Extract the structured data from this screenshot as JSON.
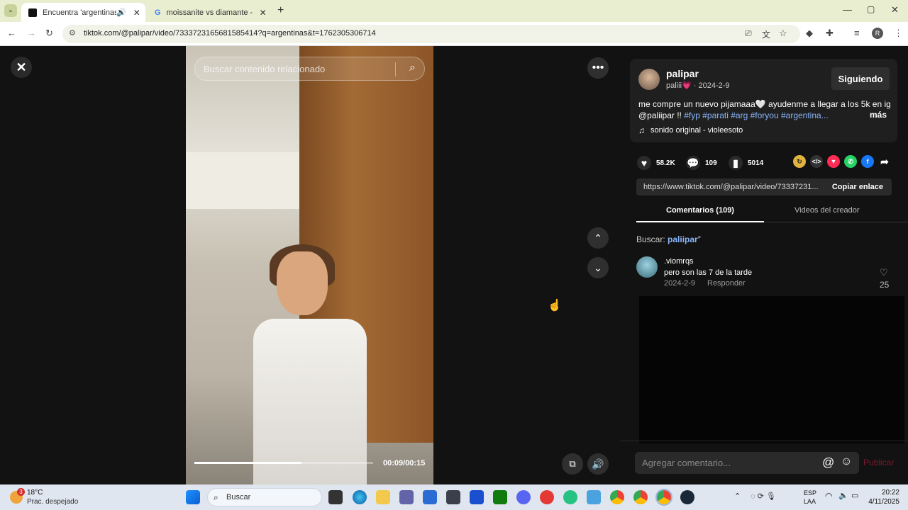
{
  "browser": {
    "tabs": [
      {
        "title": "Encuentra 'argentinas' en TikTok",
        "active": true
      },
      {
        "title": "moissanite vs diamante - Buscar",
        "active": false
      }
    ],
    "new_tab_symbol": "+",
    "url": "tiktok.com/@palipar/video/7333723165681585414?q=argentinas&t=1762305306714",
    "window_controls": [
      "minimize",
      "maximize",
      "close"
    ],
    "profile_initial": "R"
  },
  "video": {
    "search_placeholder": "Buscar contenido relacionado",
    "time": "00:09/00:15",
    "progress_fraction": 0.6
  },
  "post": {
    "username": "palipar",
    "nickname": "paliii💗",
    "date": "· 2024-2-9",
    "follow_label": "Siguiendo",
    "caption_text": "me compre un nuevo pijamaaa🤍 ayudenme a llegar a los 5k en ig @paliipar !! ",
    "hashtags": "#fyp #parati #arg #foryou #argentina...",
    "more_label": "más",
    "sound": "sonido original - violeesoto",
    "likes": "58.2K",
    "comments": "109",
    "saves": "5014",
    "link": "https://www.tiktok.com/@palipar/video/73337231...",
    "copy_label": "Copiar enlace"
  },
  "tabs": {
    "comments": "Comentarios (109)",
    "creator_videos": "Videos del creador"
  },
  "search_hint": {
    "label": "Buscar:",
    "term": "paliipar"
  },
  "comments": [
    {
      "user": ".viomrqs",
      "text": "pero son las 7 de la tarde",
      "date": "2024-2-9",
      "reply": "Responder",
      "likes": "25"
    }
  ],
  "comment_input": {
    "placeholder": "Agregar comentario...",
    "publish_label": "Publicar"
  },
  "taskbar": {
    "weather_temp": "18°C",
    "weather_desc": "Prac. despejado",
    "weather_badge": "3",
    "search_label": "Buscar",
    "lang_top": "ESP",
    "lang_bottom": "LAA",
    "time": "20:22",
    "date": "4/11/2025"
  },
  "colors": {
    "tiktok_red": "#fe2c55",
    "hashtag": "#8ab4f8",
    "panel_bg": "#121212"
  }
}
